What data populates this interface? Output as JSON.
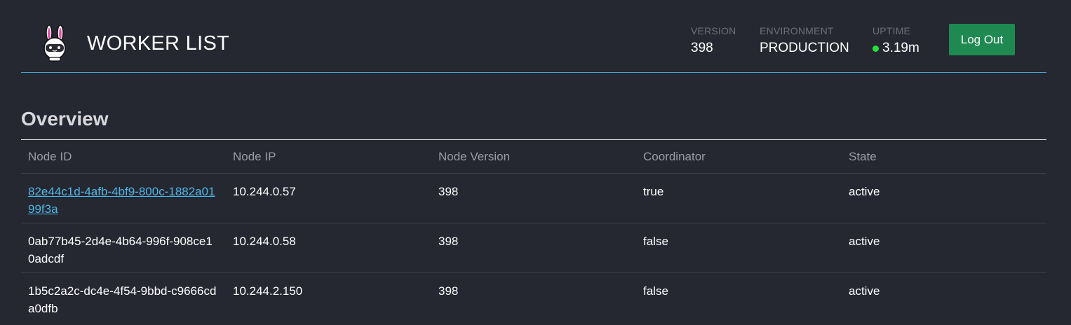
{
  "header": {
    "title": "WORKER LIST",
    "logo_icon": "bunny-astronaut-logo-icon",
    "stats": {
      "version": {
        "label": "VERSION",
        "value": "398"
      },
      "environment": {
        "label": "ENVIRONMENT",
        "value": "PRODUCTION"
      },
      "uptime": {
        "label": "UPTIME",
        "value": "3.19m",
        "status_color": "#22e03a"
      }
    },
    "logout_label": "Log Out",
    "logout_color": "#1e8a52",
    "divider_color": "#4aa3c8"
  },
  "overview": {
    "title": "Overview",
    "columns": [
      "Node ID",
      "Node IP",
      "Node Version",
      "Coordinator",
      "State"
    ],
    "rows": [
      {
        "node_id": "82e44c1d-4afb-4bf9-800c-1882a0199f3a",
        "node_ip": "10.244.0.57",
        "node_version": "398",
        "coordinator": "true",
        "state": "active",
        "linked": true
      },
      {
        "node_id": "0ab77b45-2d4e-4b64-996f-908ce10adcdf",
        "node_ip": "10.244.0.58",
        "node_version": "398",
        "coordinator": "false",
        "state": "active",
        "linked": false
      },
      {
        "node_id": "1b5c2a2c-dc4e-4f54-9bbd-c9666cda0dfb",
        "node_ip": "10.244.2.150",
        "node_version": "398",
        "coordinator": "false",
        "state": "active",
        "linked": false
      }
    ],
    "link_color": "#4cb7e6"
  }
}
